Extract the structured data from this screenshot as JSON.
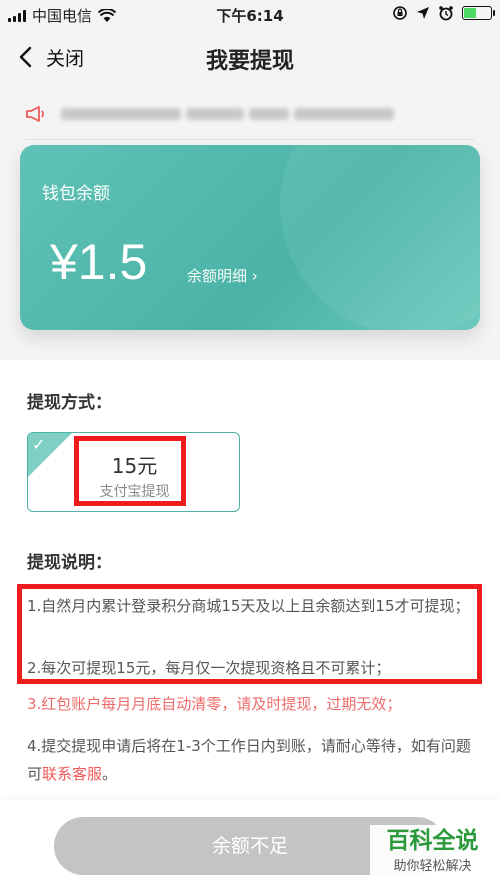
{
  "status_bar": {
    "carrier": "中国电信",
    "time": "下午6:14",
    "battery_level": 0.45
  },
  "nav": {
    "back_label": "关闭",
    "title": "我要提现"
  },
  "wallet": {
    "title": "钱包余额",
    "amount": "¥1.5",
    "detail_link": "余额明细 ›"
  },
  "method": {
    "section_title": "提现方式：",
    "options": [
      {
        "amount": "15元",
        "name": "支付宝提现",
        "selected": true
      }
    ]
  },
  "description": {
    "section_title": "提现说明：",
    "items": [
      {
        "text": "1.自然月内累计登录积分商城15天及以上且余额达到15才可提现；"
      },
      {
        "text": "2.每次可提现15元，每月仅一次提现资格且不可累计；"
      },
      {
        "text": "3.红包账户每月月底自动清零，请及时提现，过期无效；"
      },
      {
        "text": "4.提交提现申请后将在1-3个工作日内到账，请耐心等待，如有问题可",
        "link": "联系客服",
        "suffix": "。"
      }
    ]
  },
  "submit_button": "余额不足",
  "watermark": {
    "title": "百科全说",
    "subtitle": "助你轻松解决"
  },
  "colors": {
    "accent": "#4bb3a6",
    "highlight_red": "#ee1c1c",
    "warning_text": "#ee6b6b",
    "disabled_button": "#c4c4c4"
  }
}
